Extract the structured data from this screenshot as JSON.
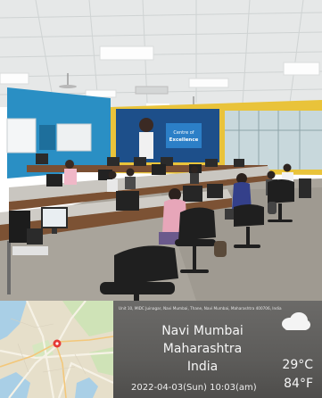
{
  "photo": {
    "banner_line1": "Centre of",
    "banner_line2": "Excellence"
  },
  "location": {
    "address": "Unit 10, MIDC Juinagar, Navi Mumbai, Thane, Navi Mumbai, Maharashtra 400706, India",
    "city": "Navi Mumbai",
    "state": "Maharashtra",
    "country": "India",
    "datetime": "2022-04-03(Sun)  10:03(am)",
    "temp_c": "29°C",
    "temp_f": "84°F",
    "weather_icon": "cloud-icon"
  },
  "colors": {
    "wall_blue": "#2a93c8",
    "ceiling": "#e8eaea",
    "floor": "#a9a49c",
    "info_panel": "#5d5c5a"
  }
}
